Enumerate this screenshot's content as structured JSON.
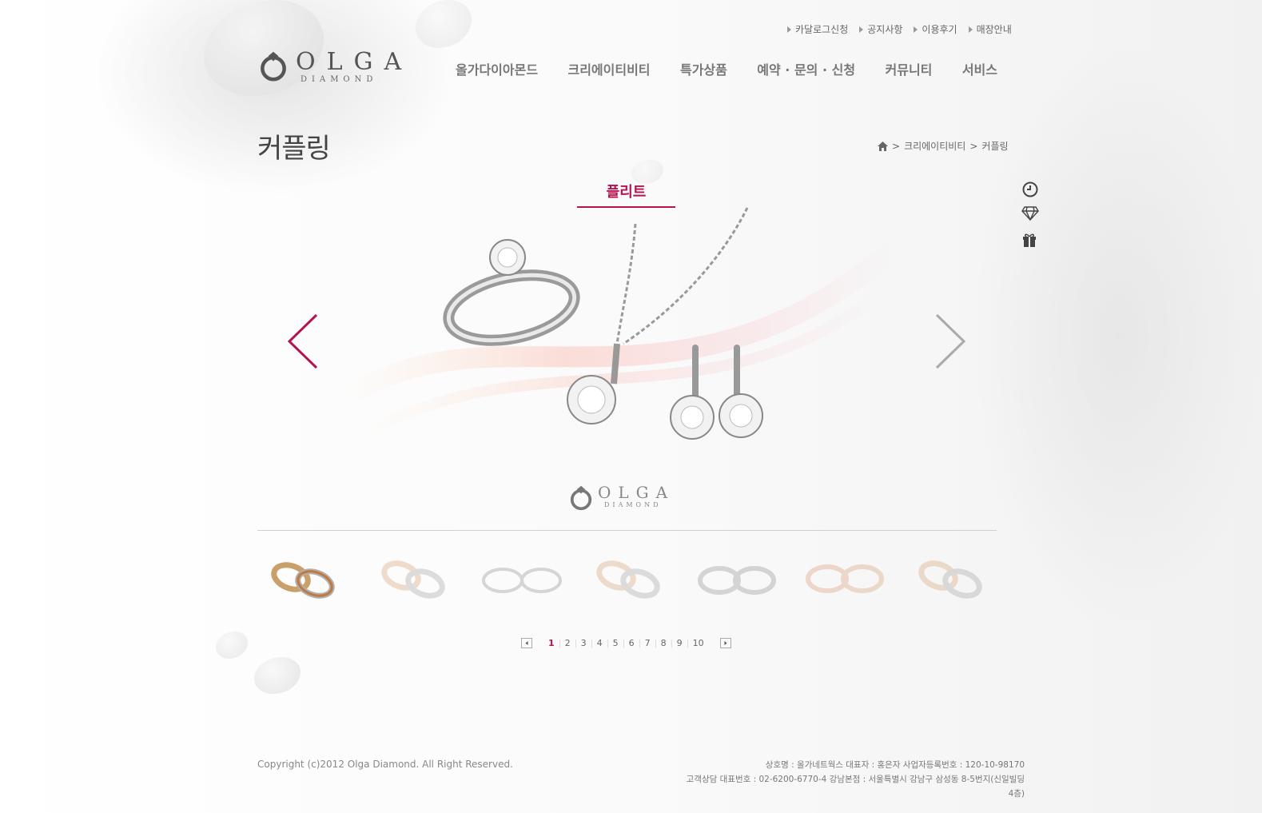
{
  "top_links": [
    "카달로그신청",
    "공지사항",
    "이용후기",
    "매장안내"
  ],
  "logo": {
    "word": "OLGA",
    "sub": "DIAMOND"
  },
  "nav": [
    "올가다이아몬드",
    "크리에이티비티",
    "특가상품",
    "예약 · 문의 · 신청",
    "커뮤니티",
    "서비스"
  ],
  "page_title": "커플링",
  "breadcrumb": {
    "level1": "크리에이티비티",
    "level2": "커플링"
  },
  "product": {
    "name": "플리트"
  },
  "side_icons": [
    "clock-icon",
    "diamond-icon",
    "gift-icon"
  ],
  "thumbnails": {
    "count": 7,
    "active_index": 0
  },
  "pagination": {
    "pages": [
      "1",
      "2",
      "3",
      "4",
      "5",
      "6",
      "7",
      "8",
      "9",
      "10"
    ],
    "active": "1"
  },
  "footer": {
    "copyright": "Copyright (c)2012 Olga Diamond. All Right Reserved.",
    "company_line1": "상호명 : 올가네트웍스    대표자 : 홍은자    사업자등록번호 : 120-10-98170",
    "company_line2": "고객상담 대표번호 : 02-6200-6770-4    강남본점 : 서울특별시 강남구 삼성동 8-5번지(신일빌딩4층)"
  },
  "colors": {
    "accent": "#b5124f",
    "arrow_next": "#aaaaaa"
  }
}
